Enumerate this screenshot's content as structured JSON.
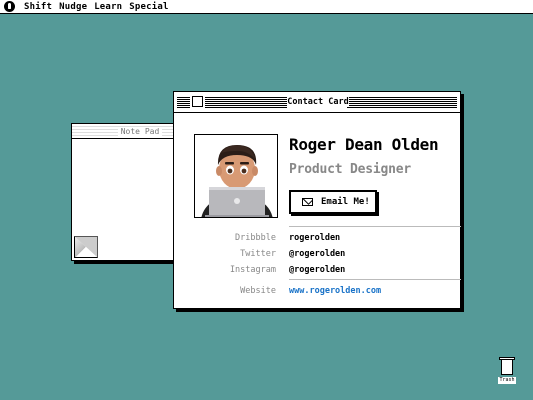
{
  "menubar": {
    "items": [
      "Shift",
      "Nudge",
      "Learn",
      "Special"
    ]
  },
  "notepad": {
    "title": "Note Pad"
  },
  "contact_card": {
    "window_title": "Contact Card",
    "name": "Roger Dean Olden",
    "role": "Product Designer",
    "email_button": "Email Me!",
    "rows": [
      {
        "label": "Dribbble",
        "value": "rogerolden"
      },
      {
        "label": "Twitter",
        "value": "@rogerolden"
      },
      {
        "label": "Instagram",
        "value": "@rogerolden"
      }
    ],
    "website": {
      "label": "Website",
      "value": "www.rogerolden.com"
    }
  },
  "trash": {
    "label": "Trash"
  },
  "colors": {
    "desktop": "#559a98",
    "link": "#1a73c8"
  }
}
